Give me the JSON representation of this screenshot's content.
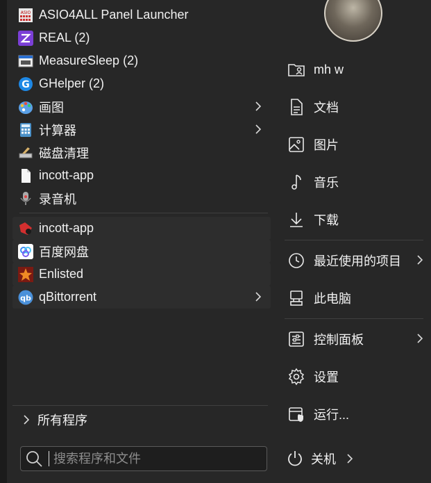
{
  "programs": [
    {
      "label": "ASIO4ALL Panel Launcher",
      "icon": "asio-icon"
    },
    {
      "label": "REAL (2)",
      "icon": "real-icon"
    },
    {
      "label": "MeasureSleep (2)",
      "icon": "measuresleep-icon"
    },
    {
      "label": "GHelper (2)",
      "icon": "ghelper-icon"
    },
    {
      "label": "画图",
      "icon": "paint-icon"
    },
    {
      "label": "计算器",
      "icon": "calculator-icon"
    },
    {
      "label": "磁盘清理",
      "icon": "disk-cleanup-icon"
    },
    {
      "label": "incott-app",
      "icon": "file-icon"
    },
    {
      "label": "录音机",
      "icon": "microphone-icon"
    }
  ],
  "pinned": [
    {
      "label": "incott-app",
      "icon": "incott-icon"
    },
    {
      "label": "百度网盘",
      "icon": "baidu-netdisk-icon"
    },
    {
      "label": "Enlisted",
      "icon": "enlisted-icon"
    },
    {
      "label": "qBittorrent",
      "icon": "qbittorrent-icon"
    }
  ],
  "all_programs_label": "所有程序",
  "search": {
    "placeholder": "搜索程序和文件"
  },
  "right": {
    "user": "mh w",
    "documents": "文档",
    "pictures": "图片",
    "music": "音乐",
    "downloads": "下载",
    "recent": "最近使用的项目",
    "this_pc": "此电脑",
    "control_panel": "控制面板",
    "settings": "设置",
    "run": "运行..."
  },
  "power": {
    "label": "关机"
  }
}
